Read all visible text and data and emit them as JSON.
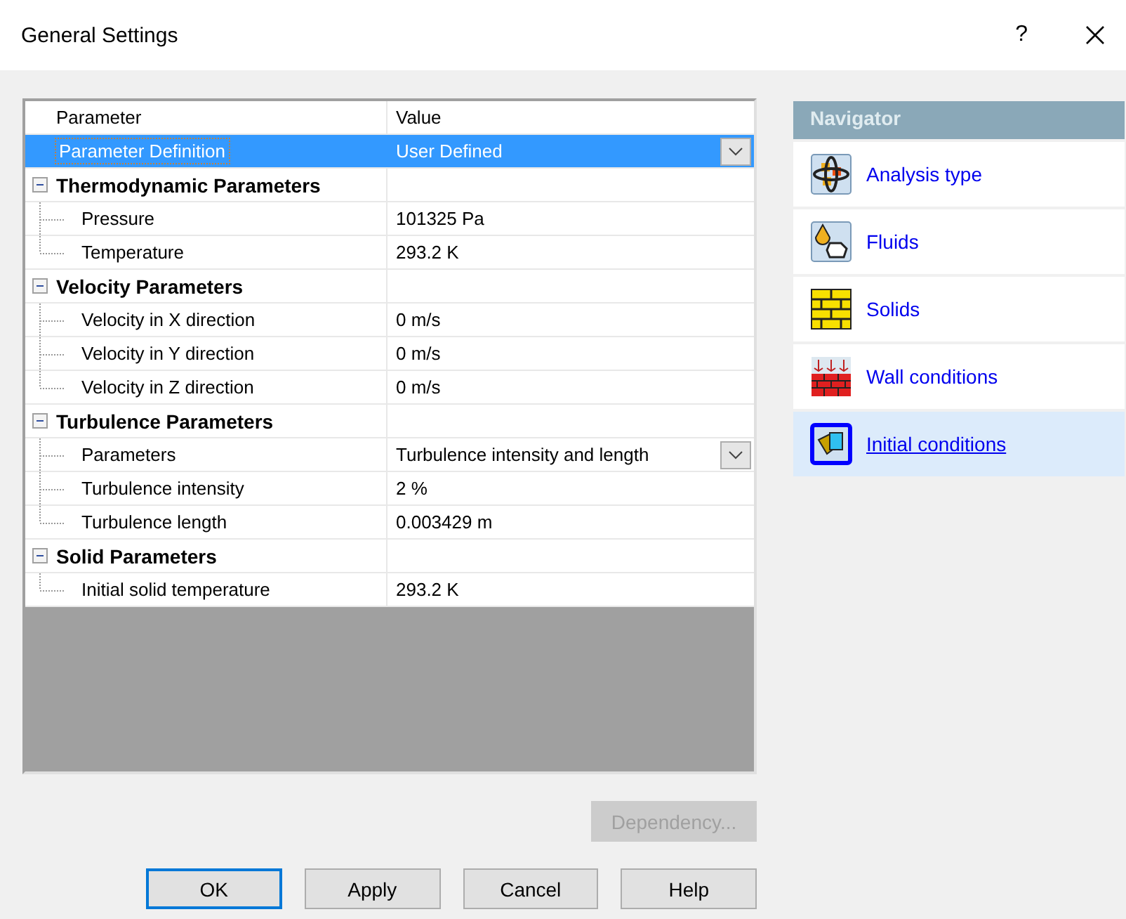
{
  "window": {
    "title": "General Settings",
    "help": "?"
  },
  "grid": {
    "columns": [
      "Parameter",
      "Value"
    ],
    "rows": [
      {
        "kind": "item",
        "label": "Parameter Definition",
        "value": "User Defined",
        "selected": true,
        "dropdown": true
      },
      {
        "kind": "group",
        "label": "Thermodynamic Parameters",
        "expanded": true,
        "children": [
          {
            "kind": "item",
            "label": "Pressure",
            "value": "101325 Pa",
            "selected": false
          },
          {
            "kind": "item",
            "label": "Temperature",
            "value": "293.2 K",
            "selected": false
          }
        ]
      },
      {
        "kind": "group",
        "label": "Velocity Parameters",
        "expanded": true,
        "children": [
          {
            "kind": "item",
            "label": "Velocity in X direction",
            "value": "0 m/s",
            "selected": false
          },
          {
            "kind": "item",
            "label": "Velocity in Y direction",
            "value": "0 m/s",
            "selected": false
          },
          {
            "kind": "item",
            "label": "Velocity in Z direction",
            "value": "0 m/s",
            "selected": false
          }
        ]
      },
      {
        "kind": "group",
        "label": "Turbulence Parameters",
        "expanded": true,
        "children": [
          {
            "kind": "item",
            "label": "Parameters",
            "value": "Turbulence intensity and length",
            "selected": false,
            "dropdown": true
          },
          {
            "kind": "item",
            "label": "Turbulence intensity",
            "value": "2 %",
            "selected": false
          },
          {
            "kind": "item",
            "label": "Turbulence length",
            "value": "0.003429 m",
            "selected": false
          }
        ]
      },
      {
        "kind": "group",
        "label": "Solid Parameters",
        "expanded": true,
        "children": [
          {
            "kind": "item",
            "label": "Initial solid temperature",
            "value": "293.2 K",
            "selected": false
          }
        ]
      }
    ]
  },
  "navigator": {
    "title": "Navigator",
    "items": [
      {
        "label": "Analysis type",
        "selected": false
      },
      {
        "label": "Fluids",
        "selected": false
      },
      {
        "label": "Solids",
        "selected": false
      },
      {
        "label": "Wall conditions",
        "selected": false
      },
      {
        "label": "Initial conditions",
        "selected": true
      }
    ]
  },
  "dependency_button": {
    "label": "Dependency...",
    "disabled": true
  },
  "buttons": [
    {
      "label": "OK",
      "default": true
    },
    {
      "label": "Apply",
      "default": false
    },
    {
      "label": "Cancel",
      "default": false
    },
    {
      "label": "Help",
      "default": false
    }
  ]
}
